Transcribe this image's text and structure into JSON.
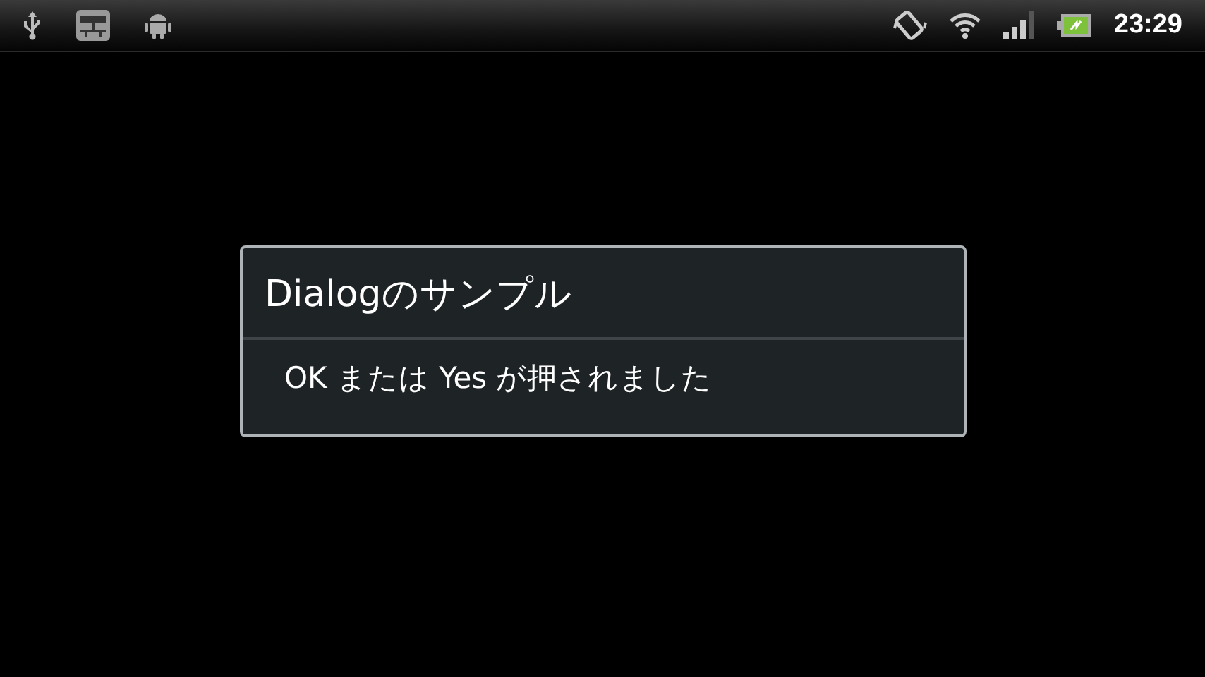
{
  "status_bar": {
    "time": "23:29"
  },
  "dialog": {
    "title": "Dialogのサンプル",
    "message": "OK または Yes が押されました"
  }
}
